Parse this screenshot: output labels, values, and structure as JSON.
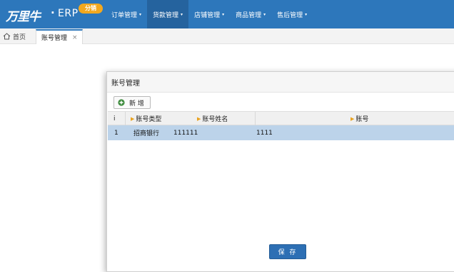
{
  "brand": {
    "logo_text": "万里牛",
    "separator": "·",
    "product": "ERP",
    "badge": "分销"
  },
  "menu": [
    {
      "label": "订单管理",
      "active": false
    },
    {
      "label": "货款管理",
      "active": true
    },
    {
      "label": "店铺管理",
      "active": false
    },
    {
      "label": "商品管理",
      "active": false
    },
    {
      "label": "售后管理",
      "active": false
    }
  ],
  "menu_caret": "▾",
  "tabs": {
    "home_label": "首页",
    "active_label": "账号管理",
    "close_glyph": "×"
  },
  "dialog": {
    "title": "账号管理",
    "add_button": "新 增",
    "columns": {
      "index": "i",
      "account_type": "账号类型",
      "account_name": "账号姓名",
      "account_number": "账号"
    },
    "rows": [
      {
        "index": "1",
        "account_type": "招商银行",
        "account_name": "111111",
        "account_number": "1111"
      }
    ],
    "save_button": "保 存"
  },
  "colors": {
    "topbar": "#2d77bb",
    "menu_active": "#25639e",
    "badge": "#f3a81e",
    "selected_row": "#bcd3ea",
    "save_button": "#2d6fb4",
    "sort_marker": "#e9a21e"
  }
}
